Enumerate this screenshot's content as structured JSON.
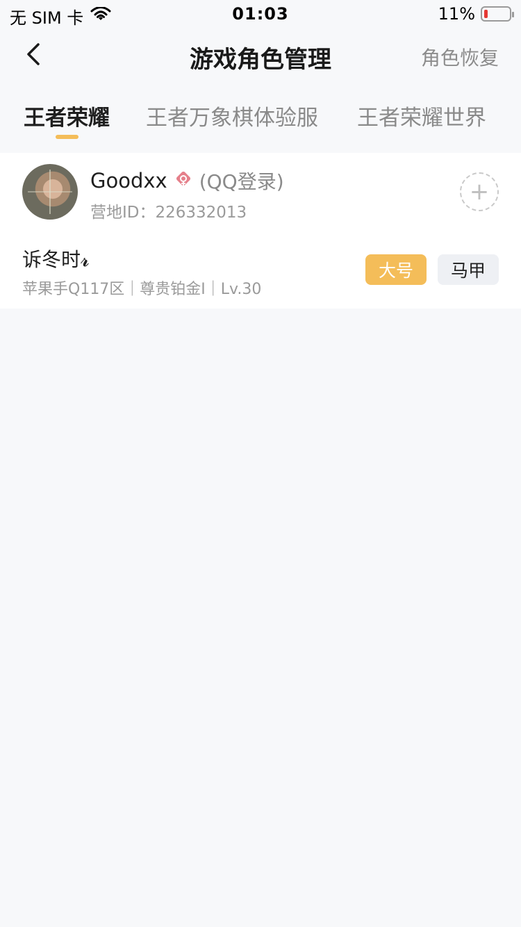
{
  "status": {
    "carrier": "无 SIM 卡",
    "time": "01:03",
    "battery": "11%"
  },
  "nav": {
    "title": "游戏角色管理",
    "restore": "角色恢复"
  },
  "tabs": [
    {
      "label": "王者荣耀",
      "active": true
    },
    {
      "label": "王者万象棋体验服",
      "active": false
    },
    {
      "label": "王者荣耀世界",
      "active": false
    }
  ],
  "user": {
    "name": "Goodxx",
    "login_type": "(QQ登录)",
    "camp_id": "营地ID：226332013"
  },
  "role": {
    "name": "诉冬时𝓻",
    "meta": "苹果手Q117区｜尊贵铂金I｜Lv.30",
    "tag_main": "大号",
    "tag_alt": "马甲"
  },
  "colors": {
    "accent": "#f4bd59",
    "background": "#f7f8fa",
    "battery_low": "#e53935",
    "gender_female": "#e57f8a"
  },
  "icons": {
    "back": "chevron-left-icon",
    "wifi": "wifi-icon",
    "battery": "battery-icon",
    "gender": "female-icon",
    "add": "plus-icon"
  }
}
